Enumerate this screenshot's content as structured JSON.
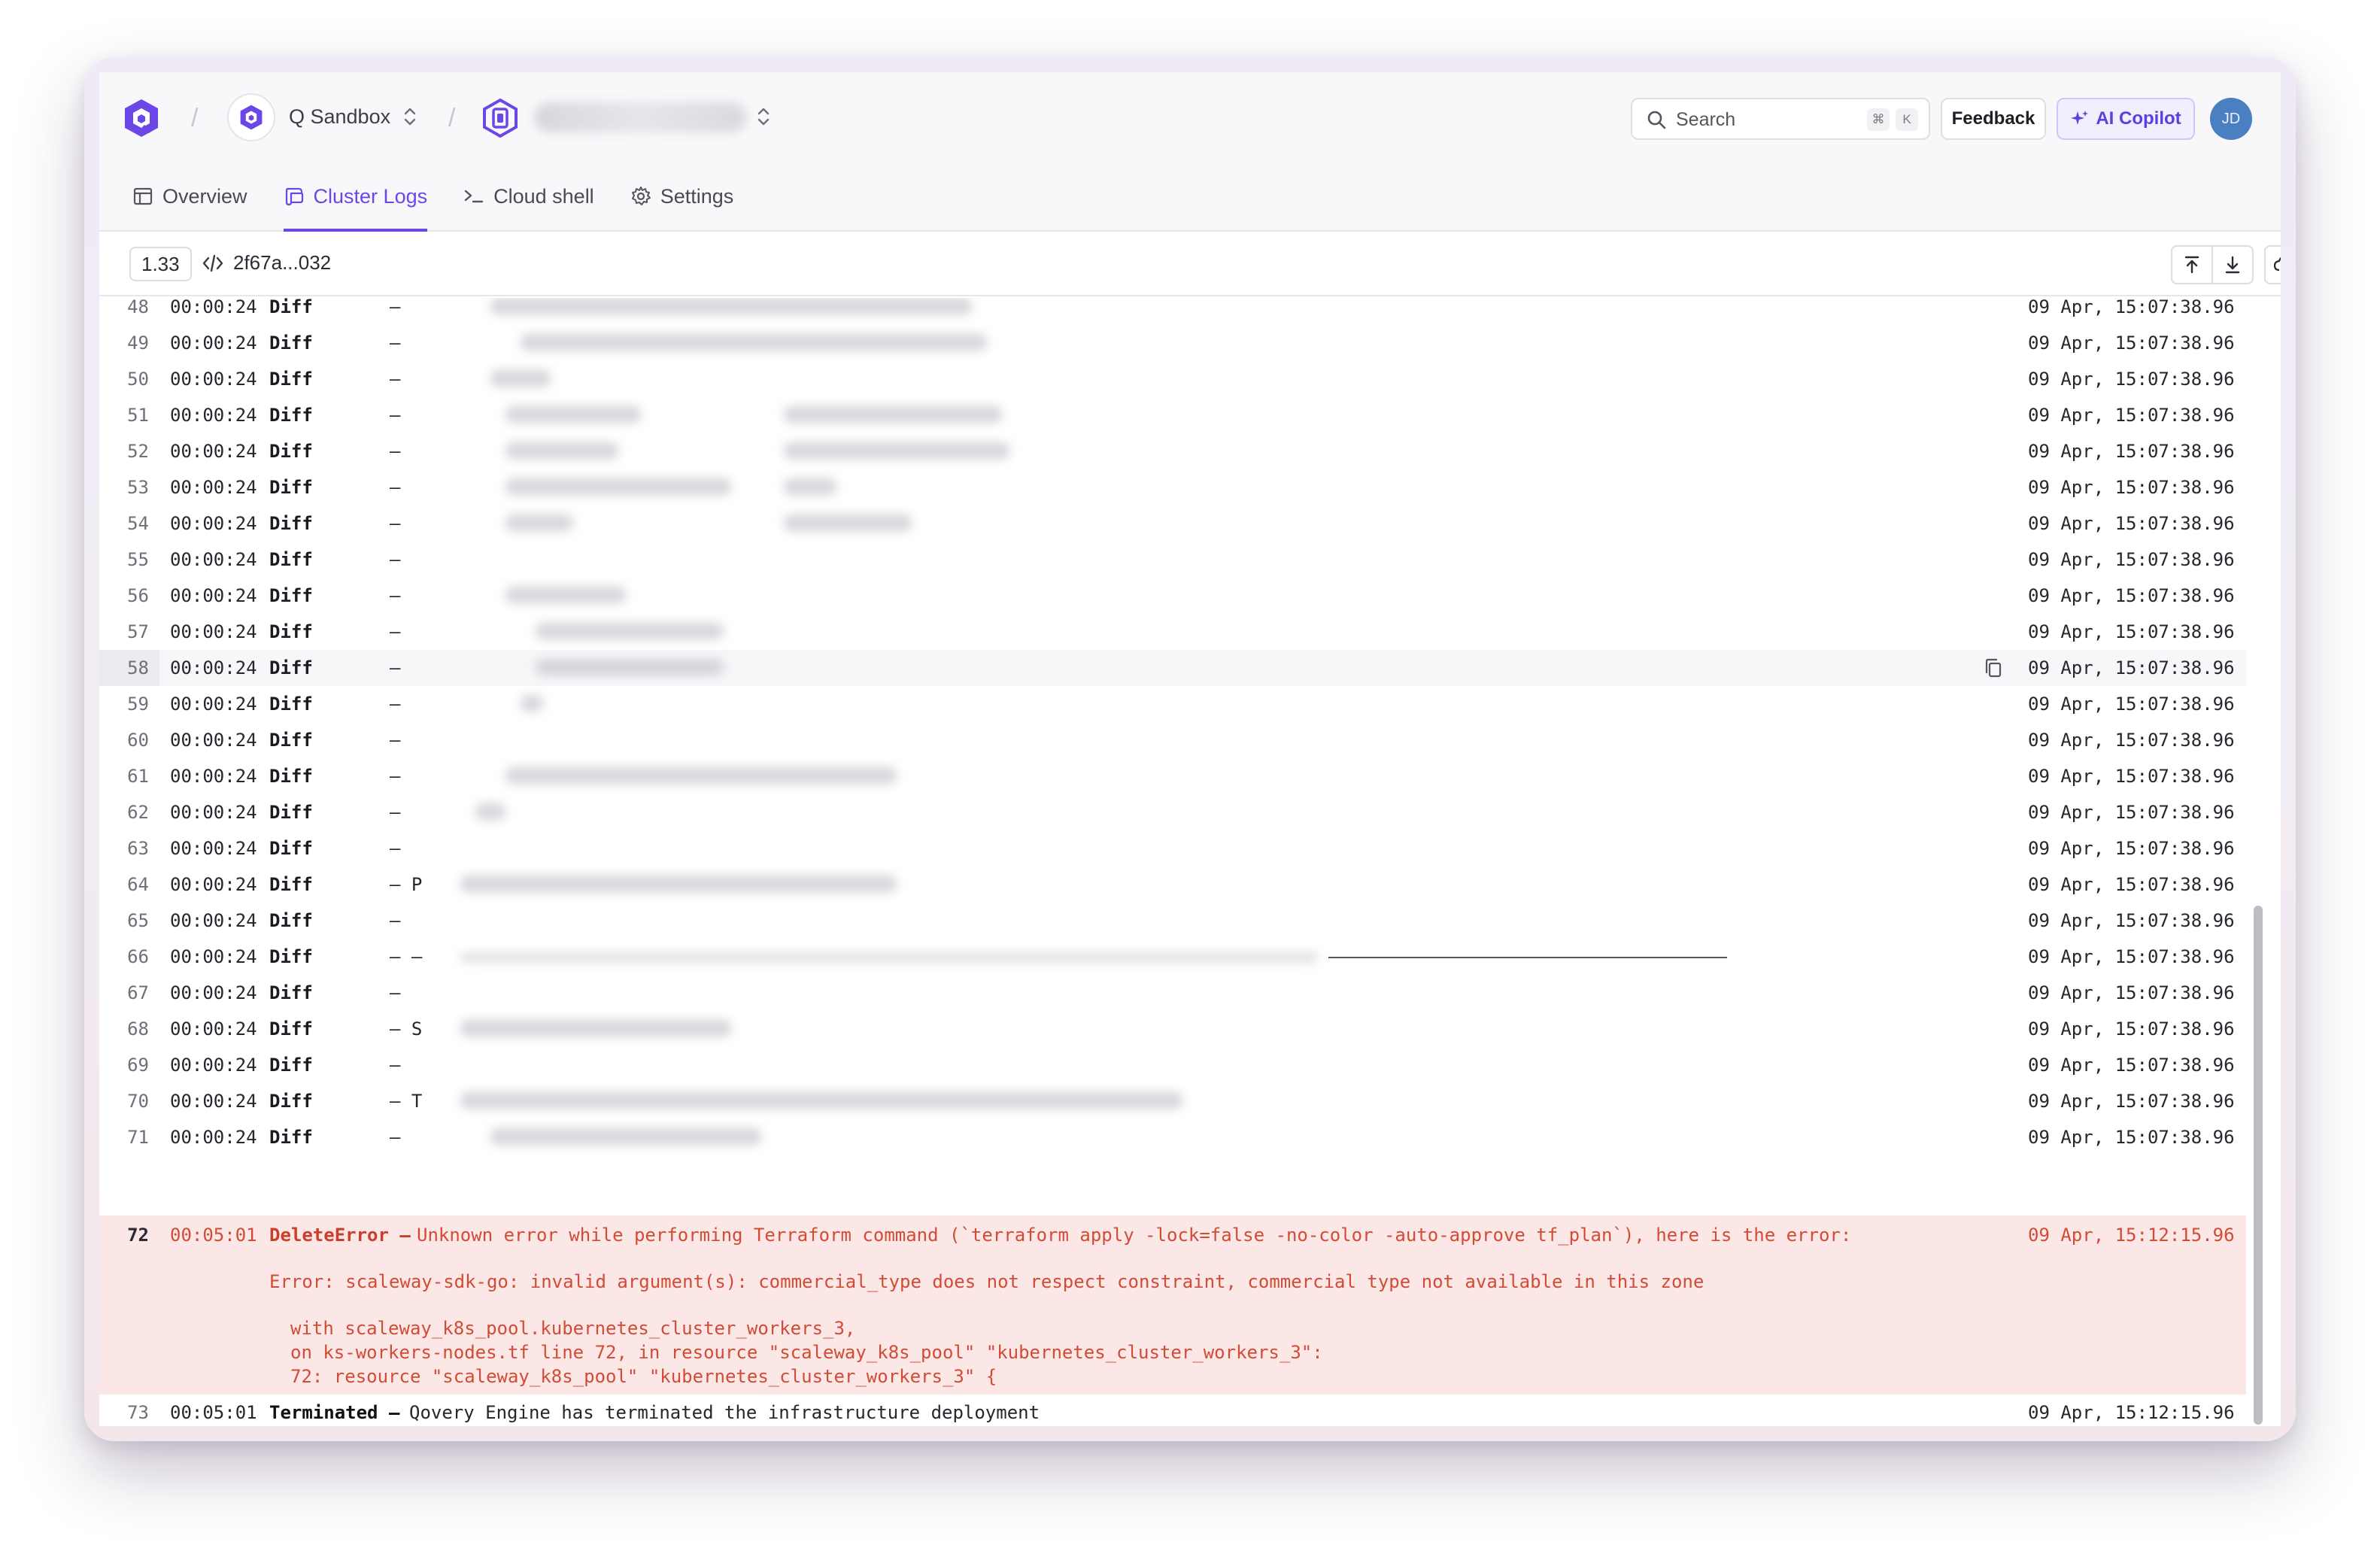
{
  "org": {
    "name": "Q Sandbox"
  },
  "search": {
    "placeholder": "Search",
    "kbd_cmd": "⌘",
    "kbd_key": "K"
  },
  "actions": {
    "feedback": "Feedback",
    "ai_copilot": "AI Copilot"
  },
  "user": {
    "initials": "JD"
  },
  "tabs": [
    {
      "label": "Overview",
      "icon": "layout-icon",
      "active": false
    },
    {
      "label": "Cluster Logs",
      "icon": "logs-icon",
      "active": true
    },
    {
      "label": "Cloud shell",
      "icon": "terminal-icon",
      "active": false
    },
    {
      "label": "Settings",
      "icon": "gear-icon",
      "active": false
    }
  ],
  "logbar": {
    "version": "1.33",
    "commit": "2f67a...032"
  },
  "logs": {
    "rows": [
      {
        "line": "48",
        "time": "00:00:24",
        "level": "Diff",
        "msg": "–",
        "date": "09 Apr, 15:07:38.96"
      },
      {
        "line": "49",
        "time": "00:00:24",
        "level": "Diff",
        "msg": "–",
        "date": "09 Apr, 15:07:38.96"
      },
      {
        "line": "50",
        "time": "00:00:24",
        "level": "Diff",
        "msg": "–",
        "date": "09 Apr, 15:07:38.96"
      },
      {
        "line": "51",
        "time": "00:00:24",
        "level": "Diff",
        "msg": "–",
        "date": "09 Apr, 15:07:38.96"
      },
      {
        "line": "52",
        "time": "00:00:24",
        "level": "Diff",
        "msg": "–",
        "date": "09 Apr, 15:07:38.96"
      },
      {
        "line": "53",
        "time": "00:00:24",
        "level": "Diff",
        "msg": "–",
        "date": "09 Apr, 15:07:38.96"
      },
      {
        "line": "54",
        "time": "00:00:24",
        "level": "Diff",
        "msg": "–",
        "date": "09 Apr, 15:07:38.96"
      },
      {
        "line": "55",
        "time": "00:00:24",
        "level": "Diff",
        "msg": "–",
        "date": "09 Apr, 15:07:38.96"
      },
      {
        "line": "56",
        "time": "00:00:24",
        "level": "Diff",
        "msg": "–",
        "date": "09 Apr, 15:07:38.96"
      },
      {
        "line": "57",
        "time": "00:00:24",
        "level": "Diff",
        "msg": "–",
        "date": "09 Apr, 15:07:38.96"
      },
      {
        "line": "58",
        "time": "00:00:24",
        "level": "Diff",
        "msg": "–",
        "date": "09 Apr, 15:07:38.96"
      },
      {
        "line": "59",
        "time": "00:00:24",
        "level": "Diff",
        "msg": "–",
        "date": "09 Apr, 15:07:38.96"
      },
      {
        "line": "60",
        "time": "00:00:24",
        "level": "Diff",
        "msg": "–",
        "date": "09 Apr, 15:07:38.96"
      },
      {
        "line": "61",
        "time": "00:00:24",
        "level": "Diff",
        "msg": "–",
        "date": "09 Apr, 15:07:38.96"
      },
      {
        "line": "62",
        "time": "00:00:24",
        "level": "Diff",
        "msg": "–",
        "date": "09 Apr, 15:07:38.96"
      },
      {
        "line": "63",
        "time": "00:00:24",
        "level": "Diff",
        "msg": "–",
        "date": "09 Apr, 15:07:38.96"
      },
      {
        "line": "64",
        "time": "00:00:24",
        "level": "Diff",
        "msg": "– P",
        "date": "09 Apr, 15:07:38.96"
      },
      {
        "line": "65",
        "time": "00:00:24",
        "level": "Diff",
        "msg": "–",
        "date": "09 Apr, 15:07:38.96"
      },
      {
        "line": "66",
        "time": "00:00:24",
        "level": "Diff",
        "msg": "– –",
        "date": "09 Apr, 15:07:38.96"
      },
      {
        "line": "67",
        "time": "00:00:24",
        "level": "Diff",
        "msg": "–",
        "date": "09 Apr, 15:07:38.96"
      },
      {
        "line": "68",
        "time": "00:00:24",
        "level": "Diff",
        "msg": "– S",
        "date": "09 Apr, 15:07:38.96"
      },
      {
        "line": "69",
        "time": "00:00:24",
        "level": "Diff",
        "msg": "–",
        "date": "09 Apr, 15:07:38.96"
      },
      {
        "line": "70",
        "time": "00:00:24",
        "level": "Diff",
        "msg": "– T",
        "date": "09 Apr, 15:07:38.96"
      },
      {
        "line": "71",
        "time": "00:00:24",
        "level": "Diff",
        "msg": "–",
        "date": "09 Apr, 15:07:38.96"
      }
    ],
    "error": {
      "line": "72",
      "time": "00:05:01",
      "level": "DeleteError –",
      "msg": "Unknown error while performing Terraform command (`terraform apply -lock=false -no-color -auto-approve tf_plan`), here is the error:",
      "date": "09 Apr, 15:12:15.96",
      "detail_1": "Error: scaleway-sdk-go: invalid argument(s): commercial_type does not respect constraint, commercial type not available in this zone",
      "detail_2": "with scaleway_k8s_pool.kubernetes_cluster_workers_3,",
      "detail_3": "on ks-workers-nodes.tf line 72, in resource \"scaleway_k8s_pool\" \"kubernetes_cluster_workers_3\":",
      "detail_4": "72: resource \"scaleway_k8s_pool\" \"kubernetes_cluster_workers_3\" {"
    },
    "terminated": {
      "line": "73",
      "time": "00:05:01",
      "level": "Terminated –",
      "msg": "Qovery Engine has terminated the infrastructure deployment",
      "date": "09 Apr, 15:12:15.96"
    }
  }
}
